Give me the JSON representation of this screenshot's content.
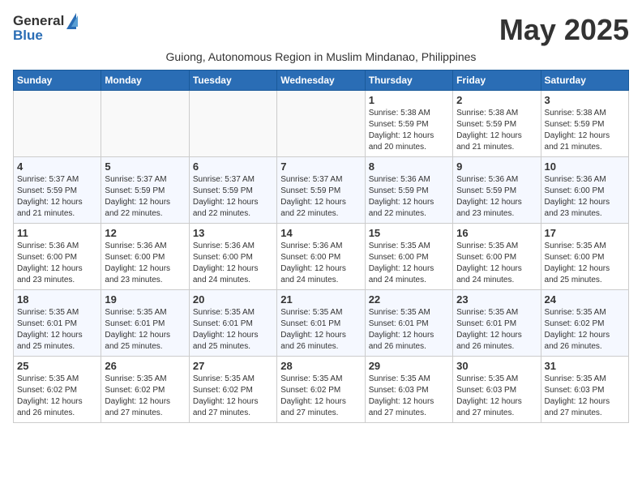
{
  "header": {
    "logo_general": "General",
    "logo_blue": "Blue",
    "month_title": "May 2025",
    "subtitle": "Guiong, Autonomous Region in Muslim Mindanao, Philippines"
  },
  "days_of_week": [
    "Sunday",
    "Monday",
    "Tuesday",
    "Wednesday",
    "Thursday",
    "Friday",
    "Saturday"
  ],
  "weeks": [
    [
      {
        "day": "",
        "info": ""
      },
      {
        "day": "",
        "info": ""
      },
      {
        "day": "",
        "info": ""
      },
      {
        "day": "",
        "info": ""
      },
      {
        "day": "1",
        "info": "Sunrise: 5:38 AM\nSunset: 5:59 PM\nDaylight: 12 hours\nand 20 minutes."
      },
      {
        "day": "2",
        "info": "Sunrise: 5:38 AM\nSunset: 5:59 PM\nDaylight: 12 hours\nand 21 minutes."
      },
      {
        "day": "3",
        "info": "Sunrise: 5:38 AM\nSunset: 5:59 PM\nDaylight: 12 hours\nand 21 minutes."
      }
    ],
    [
      {
        "day": "4",
        "info": "Sunrise: 5:37 AM\nSunset: 5:59 PM\nDaylight: 12 hours\nand 21 minutes."
      },
      {
        "day": "5",
        "info": "Sunrise: 5:37 AM\nSunset: 5:59 PM\nDaylight: 12 hours\nand 22 minutes."
      },
      {
        "day": "6",
        "info": "Sunrise: 5:37 AM\nSunset: 5:59 PM\nDaylight: 12 hours\nand 22 minutes."
      },
      {
        "day": "7",
        "info": "Sunrise: 5:37 AM\nSunset: 5:59 PM\nDaylight: 12 hours\nand 22 minutes."
      },
      {
        "day": "8",
        "info": "Sunrise: 5:36 AM\nSunset: 5:59 PM\nDaylight: 12 hours\nand 22 minutes."
      },
      {
        "day": "9",
        "info": "Sunrise: 5:36 AM\nSunset: 5:59 PM\nDaylight: 12 hours\nand 23 minutes."
      },
      {
        "day": "10",
        "info": "Sunrise: 5:36 AM\nSunset: 6:00 PM\nDaylight: 12 hours\nand 23 minutes."
      }
    ],
    [
      {
        "day": "11",
        "info": "Sunrise: 5:36 AM\nSunset: 6:00 PM\nDaylight: 12 hours\nand 23 minutes."
      },
      {
        "day": "12",
        "info": "Sunrise: 5:36 AM\nSunset: 6:00 PM\nDaylight: 12 hours\nand 23 minutes."
      },
      {
        "day": "13",
        "info": "Sunrise: 5:36 AM\nSunset: 6:00 PM\nDaylight: 12 hours\nand 24 minutes."
      },
      {
        "day": "14",
        "info": "Sunrise: 5:36 AM\nSunset: 6:00 PM\nDaylight: 12 hours\nand 24 minutes."
      },
      {
        "day": "15",
        "info": "Sunrise: 5:35 AM\nSunset: 6:00 PM\nDaylight: 12 hours\nand 24 minutes."
      },
      {
        "day": "16",
        "info": "Sunrise: 5:35 AM\nSunset: 6:00 PM\nDaylight: 12 hours\nand 24 minutes."
      },
      {
        "day": "17",
        "info": "Sunrise: 5:35 AM\nSunset: 6:00 PM\nDaylight: 12 hours\nand 25 minutes."
      }
    ],
    [
      {
        "day": "18",
        "info": "Sunrise: 5:35 AM\nSunset: 6:01 PM\nDaylight: 12 hours\nand 25 minutes."
      },
      {
        "day": "19",
        "info": "Sunrise: 5:35 AM\nSunset: 6:01 PM\nDaylight: 12 hours\nand 25 minutes."
      },
      {
        "day": "20",
        "info": "Sunrise: 5:35 AM\nSunset: 6:01 PM\nDaylight: 12 hours\nand 25 minutes."
      },
      {
        "day": "21",
        "info": "Sunrise: 5:35 AM\nSunset: 6:01 PM\nDaylight: 12 hours\nand 26 minutes."
      },
      {
        "day": "22",
        "info": "Sunrise: 5:35 AM\nSunset: 6:01 PM\nDaylight: 12 hours\nand 26 minutes."
      },
      {
        "day": "23",
        "info": "Sunrise: 5:35 AM\nSunset: 6:01 PM\nDaylight: 12 hours\nand 26 minutes."
      },
      {
        "day": "24",
        "info": "Sunrise: 5:35 AM\nSunset: 6:02 PM\nDaylight: 12 hours\nand 26 minutes."
      }
    ],
    [
      {
        "day": "25",
        "info": "Sunrise: 5:35 AM\nSunset: 6:02 PM\nDaylight: 12 hours\nand 26 minutes."
      },
      {
        "day": "26",
        "info": "Sunrise: 5:35 AM\nSunset: 6:02 PM\nDaylight: 12 hours\nand 27 minutes."
      },
      {
        "day": "27",
        "info": "Sunrise: 5:35 AM\nSunset: 6:02 PM\nDaylight: 12 hours\nand 27 minutes."
      },
      {
        "day": "28",
        "info": "Sunrise: 5:35 AM\nSunset: 6:02 PM\nDaylight: 12 hours\nand 27 minutes."
      },
      {
        "day": "29",
        "info": "Sunrise: 5:35 AM\nSunset: 6:03 PM\nDaylight: 12 hours\nand 27 minutes."
      },
      {
        "day": "30",
        "info": "Sunrise: 5:35 AM\nSunset: 6:03 PM\nDaylight: 12 hours\nand 27 minutes."
      },
      {
        "day": "31",
        "info": "Sunrise: 5:35 AM\nSunset: 6:03 PM\nDaylight: 12 hours\nand 27 minutes."
      }
    ]
  ]
}
